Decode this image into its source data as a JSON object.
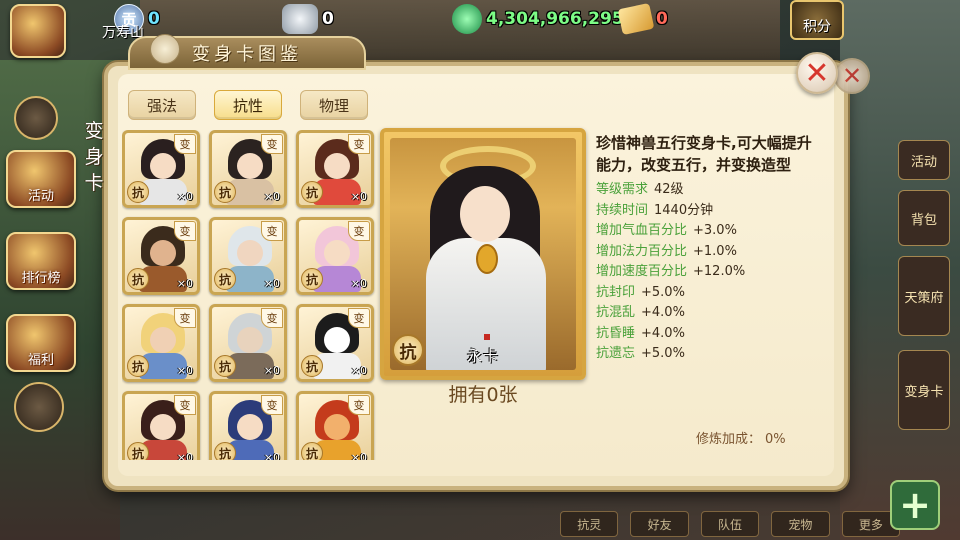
{
  "topbar": {
    "location": "万寿山",
    "resources": [
      {
        "icon": "gong-coin-icon",
        "label": "贡",
        "value": "0",
        "color": "#6fe3ff"
      },
      {
        "icon": "silver-ingot-icon",
        "label": "",
        "value": "0",
        "color": "#ffffff"
      },
      {
        "icon": "jade-coin-icon",
        "label": "",
        "value": "4,304,966,295",
        "color": "#7dfc86"
      },
      {
        "icon": "gold-ticket-icon",
        "label": "",
        "value": "0",
        "color": "#ff6a5a"
      }
    ],
    "jifen_label": "积分"
  },
  "left_menu": [
    {
      "label": "活动"
    },
    {
      "label": "排行榜"
    },
    {
      "label": "福利"
    }
  ],
  "right_menu": [
    {
      "label": "活动"
    },
    {
      "label": "背包"
    },
    {
      "label": "天策府"
    },
    {
      "label": "变身卡"
    }
  ],
  "panel": {
    "title": "变身卡图鉴",
    "side_label": "变身卡",
    "tabs": [
      {
        "label": "强法",
        "active": false
      },
      {
        "label": "抗性",
        "active": true
      },
      {
        "label": "物理",
        "active": false
      }
    ],
    "cards": [
      {
        "tag": "变",
        "badge": "抗",
        "count": "×0",
        "hair": "#2a1f1f",
        "robe": "#e6e6e6",
        "face": "#f6dcc4"
      },
      {
        "tag": "变",
        "badge": "抗",
        "count": "×0",
        "hair": "#2b2320",
        "robe": "#d9c1a3",
        "face": "#f6dcc4"
      },
      {
        "tag": "变",
        "badge": "抗",
        "count": "×0",
        "hair": "#5b2b1c",
        "robe": "#e04a3c",
        "face": "#f6dcc4"
      },
      {
        "tag": "变",
        "badge": "抗",
        "count": "×0",
        "hair": "#3b2b1c",
        "robe": "#9a5a2c",
        "face": "#e0b38e"
      },
      {
        "tag": "变",
        "badge": "抗",
        "count": "×0",
        "hair": "#dfe6ea",
        "robe": "#8db4c9",
        "face": "#f0d6c0"
      },
      {
        "tag": "变",
        "badge": "抗",
        "count": "×0",
        "hair": "#f2c6d9",
        "robe": "#b687d6",
        "face": "#f6dcc4"
      },
      {
        "tag": "变",
        "badge": "抗",
        "count": "×0",
        "hair": "#f1d27a",
        "robe": "#6a8fc9",
        "face": "#f0d0b4"
      },
      {
        "tag": "变",
        "badge": "抗",
        "count": "×0",
        "hair": "#cfd4d6",
        "robe": "#7b6b5a",
        "face": "#e8d3bd"
      },
      {
        "tag": "变",
        "badge": "抗",
        "count": "×0",
        "hair": "#1c1c1c",
        "robe": "#f1f1f1",
        "face": "#ffffff"
      },
      {
        "tag": "变",
        "badge": "抗",
        "count": "×0",
        "hair": "#3a1f1a",
        "robe": "#c8473a",
        "face": "#f6dcc4"
      },
      {
        "tag": "变",
        "badge": "抗",
        "count": "×0",
        "hair": "#2c3c7a",
        "robe": "#4e6bb8",
        "face": "#f6dcc4"
      },
      {
        "tag": "变",
        "badge": "抗",
        "count": "×0",
        "hair": "#c43b1c",
        "robe": "#e8a22c",
        "face": "#f2b06c"
      }
    ],
    "selected": {
      "name": "永卡",
      "badge": "抗",
      "owned": "拥有0张",
      "headline": "珍惜神兽五行变身卡,可大幅提升能力，改变五行，并变换造型",
      "stats": [
        {
          "key": "等级需求",
          "value": "42级"
        },
        {
          "key": "持续时间",
          "value": "1440分钟"
        },
        {
          "key": "增加气血百分比",
          "value": "+3.0%"
        },
        {
          "key": "增加法力百分比",
          "value": "+1.0%"
        },
        {
          "key": "增加速度百分比",
          "value": "+12.0%"
        },
        {
          "key": "抗封印",
          "value": "+5.0%"
        },
        {
          "key": "抗混乱",
          "value": "+4.0%"
        },
        {
          "key": "抗昏睡",
          "value": "+4.0%"
        },
        {
          "key": "抗遗忘",
          "value": "+5.0%"
        }
      ],
      "refine_label": "修炼加成：",
      "refine_value": "0%"
    }
  },
  "bottom_bar": [
    "抗灵",
    "好友",
    "队伍",
    "宠物",
    "更多"
  ],
  "plus_label": "+"
}
